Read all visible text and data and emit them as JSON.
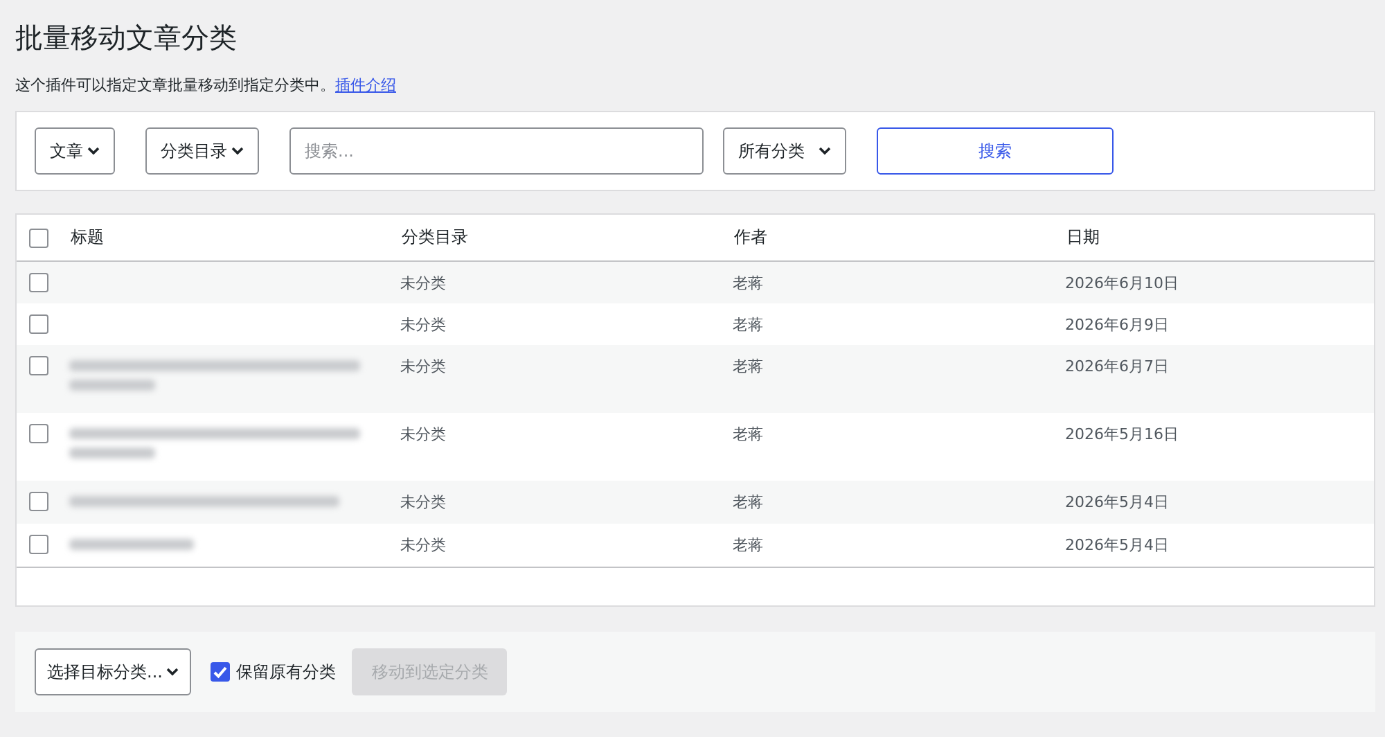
{
  "page": {
    "title": "批量移动文章分类",
    "description": "这个插件可以指定文章批量移动到指定分类中。",
    "intro_link": "插件介绍"
  },
  "filters": {
    "post_type": "文章",
    "taxonomy": "分类目录",
    "search": {
      "placeholder": "搜索..."
    },
    "category": "所有分类",
    "search_button": "搜索"
  },
  "table": {
    "select_all": {
      "checked": false
    },
    "columns": [
      "标题",
      "分类目录",
      "作者",
      "日期"
    ],
    "rows": [
      {
        "selected": false,
        "kind": "untitled",
        "category": "未分类",
        "author": "老蒋",
        "date": "2026年6月10日"
      },
      {
        "selected": false,
        "kind": "untitled",
        "category": "未分类",
        "author": "老蒋",
        "date": "2026年6月9日"
      },
      {
        "selected": false,
        "kind": "wrapped",
        "category": "未分类",
        "author": "老蒋",
        "date": "2026年6月7日"
      },
      {
        "selected": false,
        "kind": "wrapped",
        "category": "未分类",
        "author": "老蒋",
        "date": "2026年5月16日"
      },
      {
        "selected": false,
        "kind": "single",
        "category": "未分类",
        "author": "老蒋",
        "date": "2026年5月4日"
      },
      {
        "selected": false,
        "kind": "short",
        "category": "未分类",
        "author": "老蒋",
        "date": "2026年5月4日"
      }
    ]
  },
  "footer": {
    "target_category": "选择目标分类...",
    "keep_original": {
      "label": "保留原有分类",
      "checked": true
    },
    "move_button": {
      "label": "移动到选定分类",
      "disabled": true
    }
  }
}
